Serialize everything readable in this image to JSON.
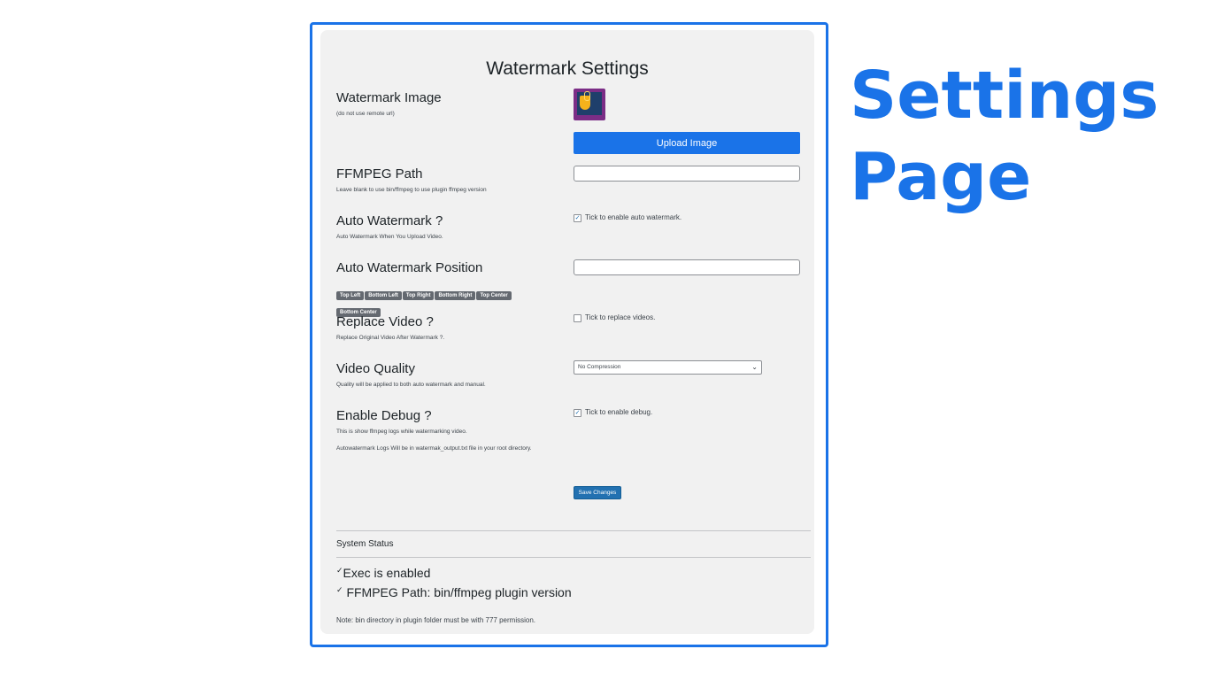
{
  "headline": {
    "line1": "Settings",
    "line2": "Page"
  },
  "settings": {
    "title": "Watermark Settings",
    "watermark_image": {
      "label": "Watermark Image",
      "desc": "(do not use remote url)",
      "upload_button": "Upload Image"
    },
    "ffmpeg_path": {
      "label": "FFMPEG Path",
      "desc": "Leave blank to use bin/ffmpeg to use plugin ffmpeg version",
      "value": ""
    },
    "auto_watermark": {
      "label": "Auto Watermark ?",
      "desc": "Auto Watermark When You Upload Video.",
      "checkbox_label": "Tick to enable auto watermark.",
      "checked": true
    },
    "auto_watermark_position": {
      "label": "Auto Watermark Position",
      "value": "",
      "tags": [
        "Top Left",
        "Bottom Left",
        "Top Right",
        "Bottom Right",
        "Top Center",
        "Bottom Center"
      ]
    },
    "replace_video": {
      "label": "Replace Video ?",
      "desc": "Replace Original Video After Watermark ?.",
      "checkbox_label": "Tick to replace videos.",
      "checked": false
    },
    "video_quality": {
      "label": "Video Quality",
      "desc": "Quality will be applied to both auto watermark and manual.",
      "selected": "No Compression"
    },
    "enable_debug": {
      "label": "Enable Debug ?",
      "desc1": "This is show ffmpeg logs while watermarking video.",
      "desc2": "Autowatermark Logs Will be in watermak_output.txt file in your root directory.",
      "checkbox_label": "Tick to enable debug.",
      "checked": true
    },
    "save_button": "Save Changes",
    "system_status": {
      "title": "System Status",
      "items": [
        "Exec is enabled",
        "FFMPEG Path: bin/ffmpeg plugin version"
      ],
      "note": "Note: bin directory in plugin folder must be with 777 permission."
    }
  },
  "colors": {
    "accent": "#1a73e8",
    "wp_button": "#2271b1",
    "tag_bg": "#646970"
  }
}
